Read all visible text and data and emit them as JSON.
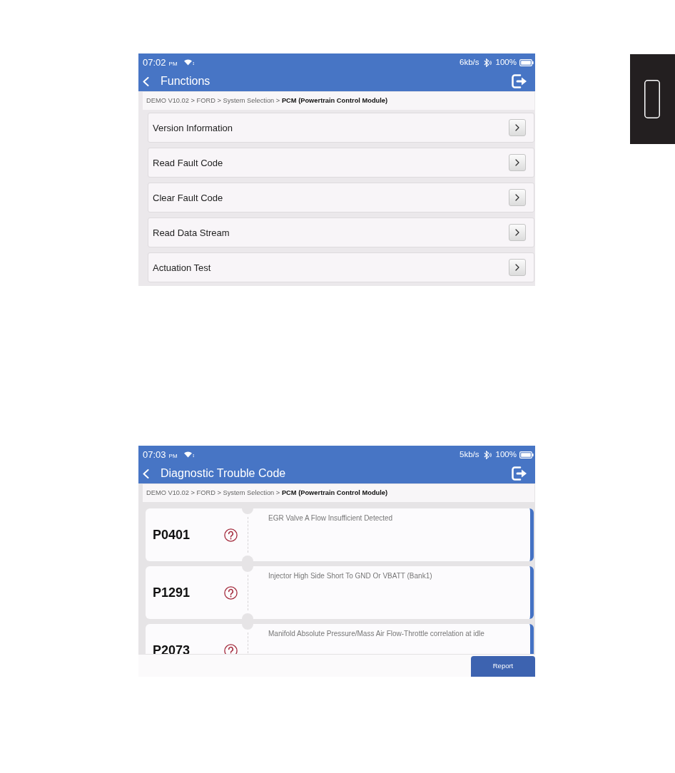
{
  "screenshots": [
    {
      "kind": "functions",
      "status_bar": {
        "time": "07:02",
        "meridiem": "PM",
        "speed": "6kb/s",
        "battery": "100%"
      },
      "title": "Functions",
      "breadcrumb": {
        "path": "DEMO V10.02 > FORD > System Selection > ",
        "current": "PCM (Powertrain Control Module)"
      },
      "menu_items": [
        {
          "label": "Version Information"
        },
        {
          "label": "Read Fault Code"
        },
        {
          "label": "Clear Fault Code"
        },
        {
          "label": "Read Data Stream"
        },
        {
          "label": "Actuation Test"
        }
      ]
    },
    {
      "kind": "dtc_list",
      "status_bar": {
        "time": "07:03",
        "meridiem": "PM",
        "speed": "5kb/s",
        "battery": "100%"
      },
      "title": "Diagnostic Trouble Code",
      "breadcrumb": {
        "path": "DEMO V10.02 > FORD > System Selection > ",
        "current": "PCM (Powertrain Control Module)"
      },
      "codes": [
        {
          "code": "P0401",
          "description": "EGR Valve A Flow Insufficient Detected"
        },
        {
          "code": "P1291",
          "description": "Injector High Side Short To GND Or VBATT (Bank1)"
        },
        {
          "code": "P2073",
          "description": "Manifold Absolute Pressure/Mass Air Flow-Throttle correlation at idle"
        }
      ],
      "report_button": "Report"
    }
  ]
}
